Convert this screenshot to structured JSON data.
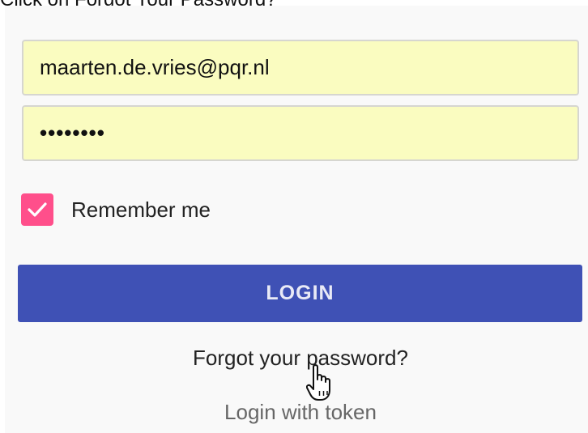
{
  "instruction": {
    "prefix": "Click on ",
    "target": "Forgot Your Password?"
  },
  "form": {
    "email_value": "maarten.de.vries@pqr.nl",
    "password_value": "••••••••",
    "remember_label": "Remember me",
    "remember_checked": true,
    "login_label": "LOGIN",
    "forgot_label": "Forgot your password?",
    "token_label": "Login with token"
  },
  "colors": {
    "autofill_bg": "#fafcc0",
    "checkbox_accent": "#ff4f8b",
    "button_primary": "#3f51b5",
    "panel_bg": "#f9f9f9"
  },
  "icons": {
    "checkbox": "check-icon",
    "cursor": "hand-pointer-cursor-icon"
  }
}
